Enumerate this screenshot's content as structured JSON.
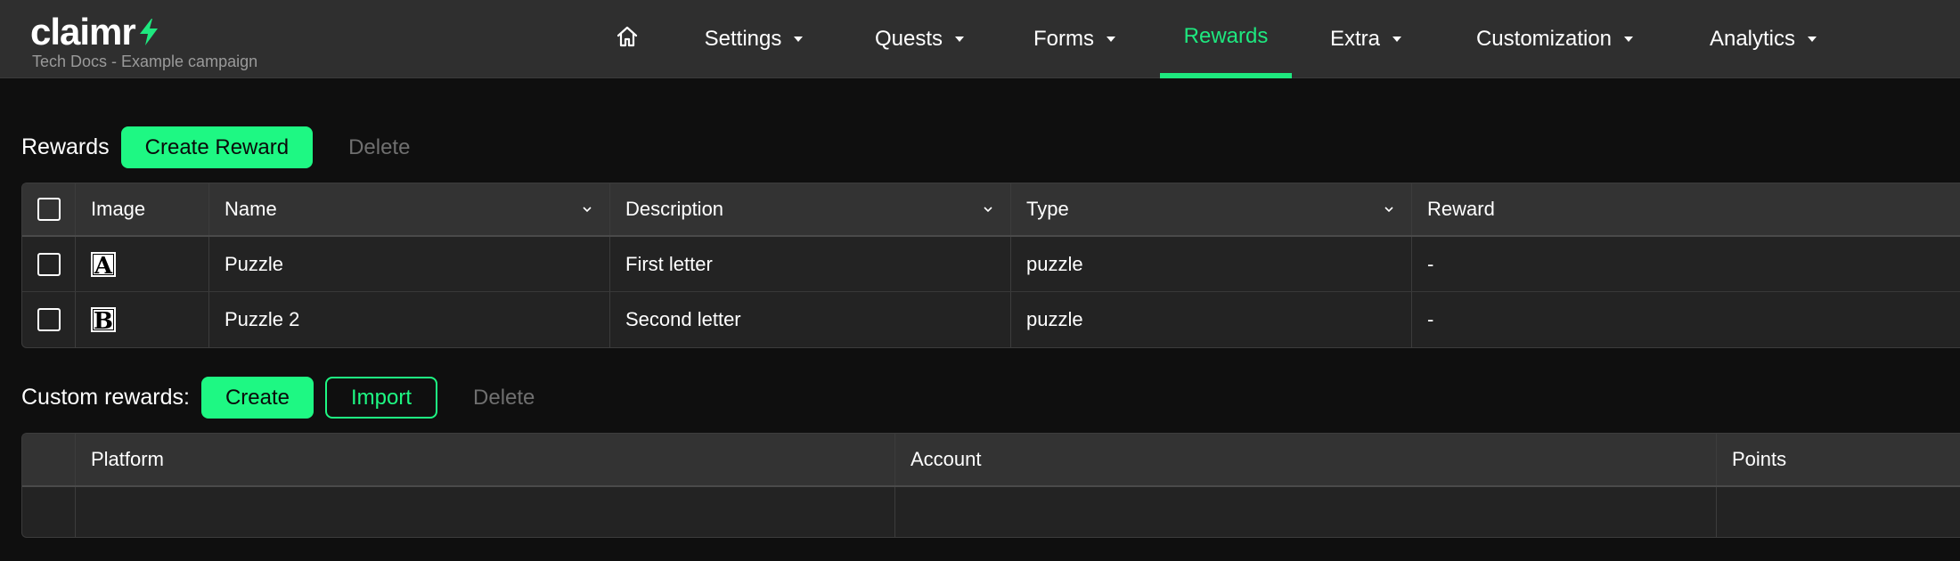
{
  "brand": {
    "name": "claimr",
    "campaign": "Tech Docs - Example campaign",
    "accent": "#1ee87f"
  },
  "nav": {
    "home_icon": "home-icon",
    "items": [
      {
        "label": "Settings",
        "has_dropdown": true
      },
      {
        "label": "Quests",
        "has_dropdown": true
      },
      {
        "label": "Forms",
        "has_dropdown": true
      },
      {
        "label": "Rewards",
        "has_dropdown": false,
        "active": true
      },
      {
        "label": "Extra",
        "has_dropdown": true
      },
      {
        "label": "Customization",
        "has_dropdown": true
      },
      {
        "label": "Analytics",
        "has_dropdown": true
      }
    ]
  },
  "rewards": {
    "label": "Rewards",
    "create_label": "Create Reward",
    "delete_label": "Delete",
    "columns": [
      "Image",
      "Name",
      "Description",
      "Type",
      "Reward"
    ],
    "rows": [
      {
        "image": "A",
        "name": "Puzzle",
        "description": "First letter",
        "type": "puzzle",
        "reward": "-"
      },
      {
        "image": "B",
        "name": "Puzzle 2",
        "description": "Second letter",
        "type": "puzzle",
        "reward": "-"
      }
    ]
  },
  "custom_rewards": {
    "label": "Custom rewards:",
    "create_label": "Create",
    "import_label": "Import",
    "delete_label": "Delete",
    "columns": [
      "Platform",
      "Account",
      "Points"
    ]
  }
}
